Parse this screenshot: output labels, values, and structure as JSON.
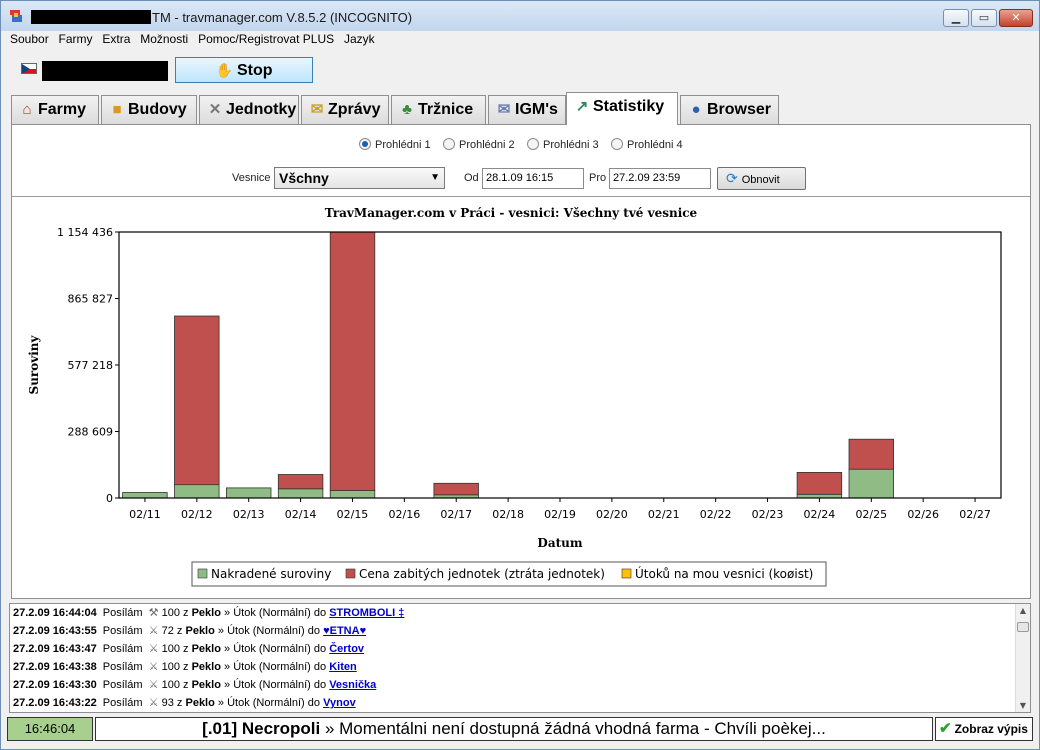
{
  "window": {
    "title": "TM - travmanager.com V.8.5.2 (INCOGNITO)",
    "controls": {
      "minimize": "▁",
      "maximize": "▭",
      "close": "✕"
    }
  },
  "menu": [
    "Soubor",
    "Farmy",
    "Extra",
    "Možnosti",
    "Pomoc/Registrovat PLUS",
    "Jazyk"
  ],
  "toolbar": {
    "stop_label": "Stop"
  },
  "tabs": [
    {
      "label": "Farmy",
      "icon": "farm-icon"
    },
    {
      "label": "Budovy",
      "icon": "buildings-icon"
    },
    {
      "label": "Jednotky",
      "icon": "swords-icon"
    },
    {
      "label": "Zprávy",
      "icon": "reports-icon"
    },
    {
      "label": "Tržnice",
      "icon": "market-icon"
    },
    {
      "label": "IGM's",
      "icon": "messages-icon"
    },
    {
      "label": "Statistiky",
      "icon": "statistics-icon",
      "active": true
    },
    {
      "label": "Browser",
      "icon": "globe-icon"
    }
  ],
  "views": {
    "options": [
      "Prohlédni 1",
      "Prohlédni 2",
      "Prohlédni 3",
      "Prohlédni 4"
    ],
    "selected": 0
  },
  "filter": {
    "village_label": "Vesnice",
    "village_value": "Všchny",
    "from_label": "Od",
    "from_value": "28.1.09 16:15",
    "to_label": "Pro",
    "to_value": "27.2.09 23:59",
    "refresh_label": "Obnovit"
  },
  "chart_data": {
    "type": "bar",
    "stacked": true,
    "title": "TravManager.com v Práci - vesnici: Všechny tvé vesnice",
    "xlabel": "Datum",
    "ylabel": "Suroviny",
    "ylim": [
      0,
      1154436
    ],
    "yticks": [
      0,
      288609,
      577218,
      865827,
      1154436
    ],
    "ytick_labels": [
      "0",
      "288 609",
      "577 218",
      "865 827",
      "1 154 436"
    ],
    "categories": [
      "02/11",
      "02/12",
      "02/13",
      "02/14",
      "02/15",
      "02/16",
      "02/17",
      "02/18",
      "02/19",
      "02/20",
      "02/21",
      "02/22",
      "02/23",
      "02/24",
      "02/25",
      "02/26",
      "02/27"
    ],
    "series": [
      {
        "name": "Nakradené suroviny",
        "color": "#8fbc85",
        "values": [
          24000,
          58000,
          44000,
          40000,
          32000,
          0,
          14000,
          0,
          0,
          0,
          0,
          0,
          0,
          16000,
          125000,
          0,
          0
        ]
      },
      {
        "name": "Cena zabitých jednotek (ztráta jednotek)",
        "color": "#c0504d",
        "values": [
          0,
          732000,
          0,
          62000,
          1122436,
          0,
          50000,
          0,
          0,
          0,
          0,
          0,
          0,
          95000,
          130000,
          0,
          0
        ]
      },
      {
        "name": "Útoků na mou vesnici (koøist)",
        "color": "#ffc000",
        "values": [
          0,
          0,
          0,
          0,
          0,
          0,
          0,
          0,
          0,
          0,
          0,
          0,
          0,
          0,
          0,
          0,
          0
        ]
      }
    ],
    "legend_position": "bottom",
    "grid": false
  },
  "log": [
    {
      "time": "27.2.09 16:44:04",
      "action": "Posílám",
      "unit_icon": "catapult-icon",
      "count": "100",
      "from_word": "z",
      "source": "Peklo",
      "arrow": "»",
      "kind": "Útok (Normální)",
      "to_word": "do",
      "target": "STROMBOLI ‡"
    },
    {
      "time": "27.2.09 16:43:55",
      "action": "Posílám",
      "unit_icon": "axe-icon",
      "count": "72",
      "from_word": "z",
      "source": "Peklo",
      "arrow": "»",
      "kind": "Útok (Normální)",
      "to_word": "do",
      "target": "♥ETNA♥"
    },
    {
      "time": "27.2.09 16:43:47",
      "action": "Posílám",
      "unit_icon": "axe-icon",
      "count": "100",
      "from_word": "z",
      "source": "Peklo",
      "arrow": "»",
      "kind": "Útok (Normální)",
      "to_word": "do",
      "target": "Čertov"
    },
    {
      "time": "27.2.09 16:43:38",
      "action": "Posílám",
      "unit_icon": "axe-icon",
      "count": "100",
      "from_word": "z",
      "source": "Peklo",
      "arrow": "»",
      "kind": "Útok (Normální)",
      "to_word": "do",
      "target": "Kiten"
    },
    {
      "time": "27.2.09 16:43:30",
      "action": "Posílám",
      "unit_icon": "axe-icon",
      "count": "100",
      "from_word": "z",
      "source": "Peklo",
      "arrow": "»",
      "kind": "Útok (Normální)",
      "to_word": "do",
      "target": "Vesnička"
    },
    {
      "time": "27.2.09 16:43:22",
      "action": "Posílám",
      "unit_icon": "axe-icon",
      "count": "93",
      "from_word": "z",
      "source": "Peklo",
      "arrow": "»",
      "kind": "Útok (Normální)",
      "to_word": "do",
      "target": "Vynov"
    }
  ],
  "status": {
    "clock": "16:46:04",
    "prefix": "[.01] Necropoli",
    "message": " » Momentálni není dostupná žádná vhodná farma - Chvíli poèkej...",
    "show_label": "Zobraz výpis"
  }
}
